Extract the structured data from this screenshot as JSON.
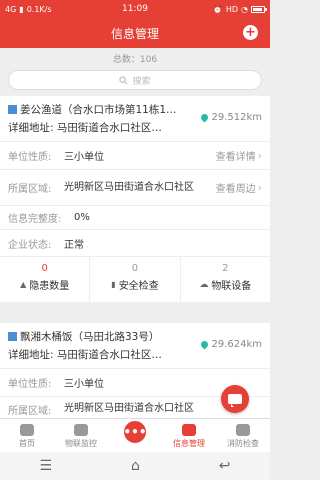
{
  "statusbar": {
    "network": "4G",
    "speed": "0.1K/s",
    "time": "11:09",
    "right_text": "HD",
    "battery_level": 0.85
  },
  "header": {
    "title": "信息管理",
    "add_symbol": "+"
  },
  "summary": {
    "total": "总数：106"
  },
  "search": {
    "placeholder": "搜索"
  },
  "cards": [
    {
      "name": "姜公渔道（合水口市场第11栋1…",
      "address": "详细地址:  马田街道合水口社区…",
      "distance": "29.512km",
      "unit_label": "单位性质:",
      "unit_value": "三小单位",
      "unit_action": "查看详情",
      "area_label": "所属区域:",
      "area_value": "光明新区马田街道合水口社区",
      "area_action": "查看周边",
      "completeness_label": "信息完整度:",
      "completeness_value": "0%",
      "status_label": "企业状态:",
      "status_value": "正常",
      "stats": [
        {
          "count": "0",
          "label": "隐患数量"
        },
        {
          "count": "0",
          "label": "安全检查"
        },
        {
          "count": "2",
          "label": "物联设备"
        }
      ]
    },
    {
      "name": "飘湘木桶饭（马田北路33号）",
      "address": "详细地址:  马田街道合水口社区…",
      "distance": "29.624km",
      "unit_label": "单位性质:",
      "unit_value": "三小单位",
      "area_label": "所属区域:",
      "area_value": "光明新区马田街道合水口社区"
    }
  ],
  "tabbar": {
    "tabs": [
      {
        "label": "首页"
      },
      {
        "label": "物联监控"
      },
      {
        "label": ""
      },
      {
        "label": "信息管理"
      },
      {
        "label": "消防检查"
      }
    ],
    "active_index": 3,
    "middle_symbol": "•••"
  },
  "colors": {
    "brand": "#e53f36",
    "accent_teal": "#2ab7a9",
    "building_blue": "#4a8fd4"
  },
  "navbar": {
    "menu": "☰",
    "home": "⌂",
    "back": "↩"
  }
}
